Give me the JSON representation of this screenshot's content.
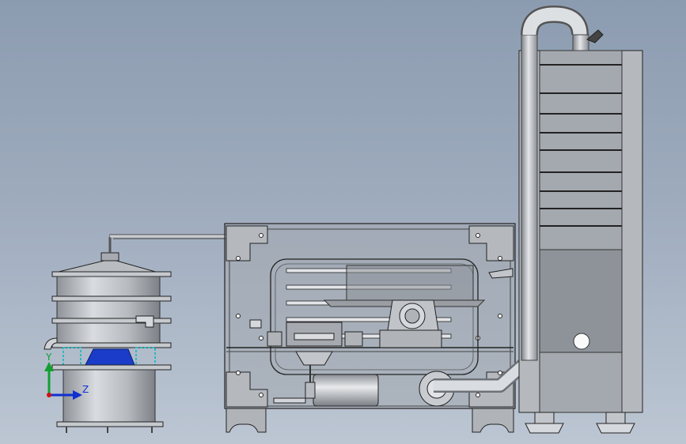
{
  "viewport": {
    "background_top": "#8c9cb0",
    "background_bottom": "#bcc6d3"
  },
  "triad": {
    "y_label": "Y",
    "z_label": "Z",
    "x_color": "#d01010",
    "y_color": "#10a030",
    "z_color": "#1030d0"
  },
  "colors": {
    "steel": "#b8bcc2",
    "steel_dark": "#5a5e64",
    "housing_fill": "#a3a8ae",
    "spring": "#2fb8c0",
    "blue_part": "#1a3cc8",
    "outline": "#1c1c1c"
  }
}
